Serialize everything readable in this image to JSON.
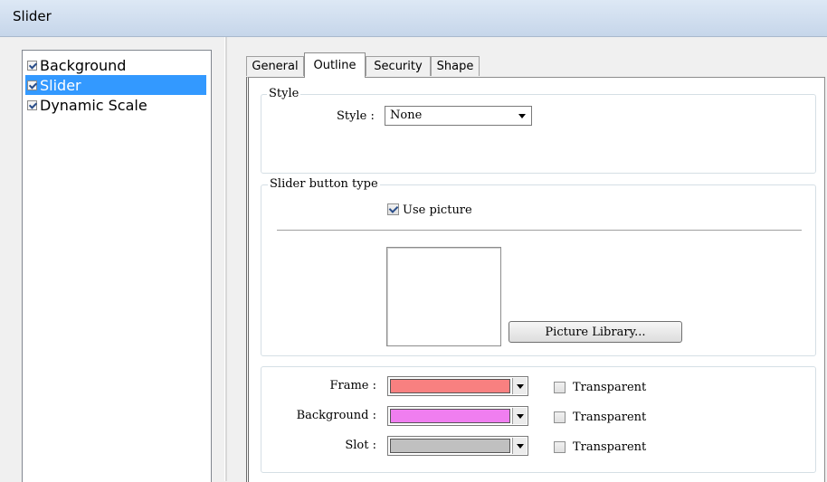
{
  "window": {
    "title": "Slider"
  },
  "tree": {
    "items": [
      {
        "label": "Background",
        "checked": true,
        "selected": false
      },
      {
        "label": "Slider",
        "checked": true,
        "selected": true
      },
      {
        "label": "Dynamic Scale",
        "checked": true,
        "selected": false
      }
    ]
  },
  "tabs": [
    {
      "label": "General",
      "active": false
    },
    {
      "label": "Outline",
      "active": true
    },
    {
      "label": "Security",
      "active": false
    },
    {
      "label": "Shape",
      "active": false
    }
  ],
  "style_group": {
    "title": "Style",
    "style_label": "Style :",
    "style_value": "None"
  },
  "button_type_group": {
    "title": "Slider button type",
    "use_picture_label": "Use picture",
    "use_picture_checked": true,
    "picture_library_label": "Picture Library..."
  },
  "colors_group": {
    "frame_label": "Frame :",
    "frame_color": "#f88080",
    "background_label": "Background :",
    "background_color": "#f07ef0",
    "slot_label": "Slot :",
    "slot_color": "#c0c0c0",
    "transparent_label": "Transparent"
  }
}
